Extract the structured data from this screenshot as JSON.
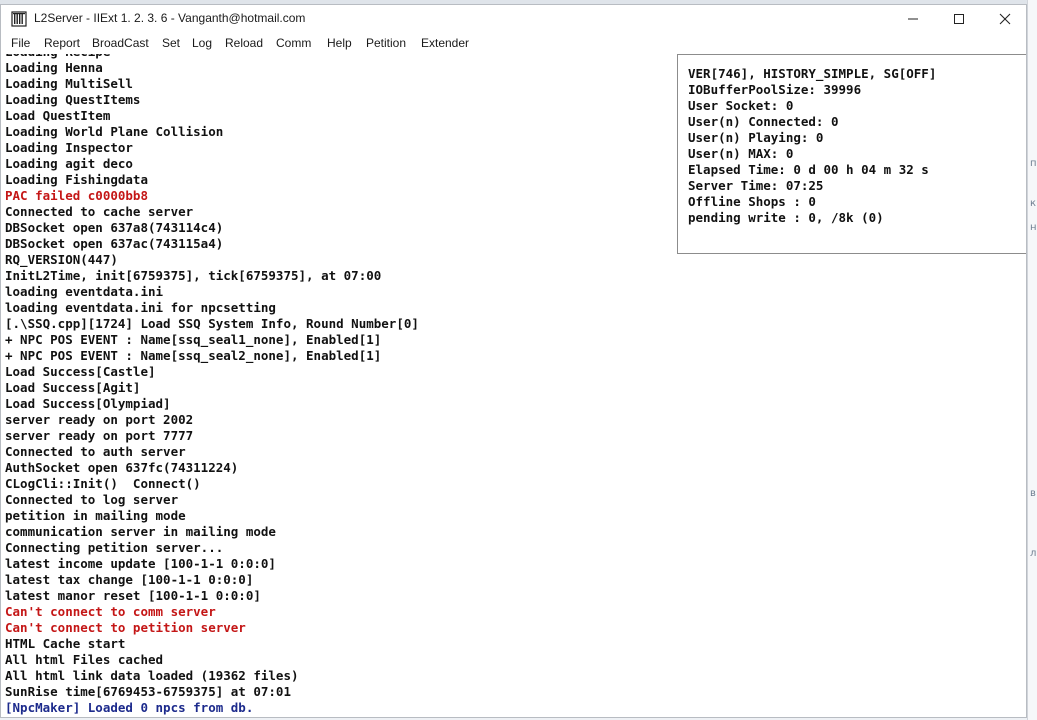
{
  "window": {
    "title": "L2Server - IIExt 1. 2. 3. 6 - Vanganth@hotmail.com"
  },
  "menu": [
    {
      "label": "File"
    },
    {
      "label": "Report"
    },
    {
      "label": "BroadCast"
    },
    {
      "label": "Set"
    },
    {
      "label": "Log"
    },
    {
      "label": "Reload"
    },
    {
      "label": "Comm"
    },
    {
      "label": "Help"
    },
    {
      "label": "Petition"
    },
    {
      "label": "Extender"
    }
  ],
  "status_panel": [
    "VER[746], HISTORY_SIMPLE, SG[OFF]",
    "IOBufferPoolSize: 39996",
    "User Socket: 0",
    "User(n) Connected: 0",
    "User(n) Playing: 0",
    "User(n) MAX: 0",
    "Elapsed Time: 0 d 00 h 04 m 32 s",
    "Server Time: 07:25",
    "Offline Shops : 0",
    "pending write : 0, /8k (0)"
  ],
  "log": [
    {
      "text": "Loading Recipe",
      "style": "normal"
    },
    {
      "text": "Loading Henna",
      "style": "normal"
    },
    {
      "text": "Loading MultiSell",
      "style": "normal"
    },
    {
      "text": "Loading QuestItems",
      "style": "normal"
    },
    {
      "text": "Load QuestItem",
      "style": "normal"
    },
    {
      "text": "Loading World Plane Collision",
      "style": "normal"
    },
    {
      "text": "Loading Inspector",
      "style": "normal"
    },
    {
      "text": "Loading agit deco",
      "style": "normal"
    },
    {
      "text": "Loading Fishingdata",
      "style": "normal"
    },
    {
      "text": "PAC failed c0000bb8",
      "style": "err"
    },
    {
      "text": "Connected to cache server",
      "style": "normal"
    },
    {
      "text": "DBSocket open 637a8(743114c4)",
      "style": "normal"
    },
    {
      "text": "DBSocket open 637ac(743115a4)",
      "style": "normal"
    },
    {
      "text": "RQ_VERSION(447)",
      "style": "normal"
    },
    {
      "text": "InitL2Time, init[6759375], tick[6759375], at 07:00",
      "style": "normal"
    },
    {
      "text": "loading eventdata.ini",
      "style": "normal"
    },
    {
      "text": "loading eventdata.ini for npcsetting",
      "style": "normal"
    },
    {
      "text": "[.\\SSQ.cpp][1724] Load SSQ System Info, Round Number[0]",
      "style": "normal"
    },
    {
      "text": "+ NPC POS EVENT : Name[ssq_seal1_none], Enabled[1]",
      "style": "normal"
    },
    {
      "text": "+ NPC POS EVENT : Name[ssq_seal2_none], Enabled[1]",
      "style": "normal"
    },
    {
      "text": "Load Success[Castle]",
      "style": "normal"
    },
    {
      "text": "Load Success[Agit]",
      "style": "normal"
    },
    {
      "text": "Load Success[Olympiad]",
      "style": "normal"
    },
    {
      "text": "server ready on port 2002",
      "style": "normal"
    },
    {
      "text": "server ready on port 7777",
      "style": "normal"
    },
    {
      "text": "Connected to auth server",
      "style": "normal"
    },
    {
      "text": "AuthSocket open 637fc(74311224)",
      "style": "normal"
    },
    {
      "text": "CLogCli::Init()  Connect()",
      "style": "normal"
    },
    {
      "text": "Connected to log server",
      "style": "normal"
    },
    {
      "text": "petition in mailing mode",
      "style": "normal"
    },
    {
      "text": "communication server in mailing mode",
      "style": "normal"
    },
    {
      "text": "Connecting petition server...",
      "style": "normal"
    },
    {
      "text": "latest income update [100-1-1 0:0:0]",
      "style": "normal"
    },
    {
      "text": "latest tax change [100-1-1 0:0:0]",
      "style": "normal"
    },
    {
      "text": "latest manor reset [100-1-1 0:0:0]",
      "style": "normal"
    },
    {
      "text": "Can't connect to comm server",
      "style": "err"
    },
    {
      "text": "Can't connect to petition server",
      "style": "err"
    },
    {
      "text": "HTML Cache start",
      "style": "normal"
    },
    {
      "text": "All html Files cached",
      "style": "normal"
    },
    {
      "text": "All html link data loaded (19362 files)",
      "style": "normal"
    },
    {
      "text": "SunRise time[6769453-6759375] at 07:01",
      "style": "normal"
    },
    {
      "text": "[NpcMaker] Loaded 0 npcs from db.",
      "style": "info"
    }
  ]
}
